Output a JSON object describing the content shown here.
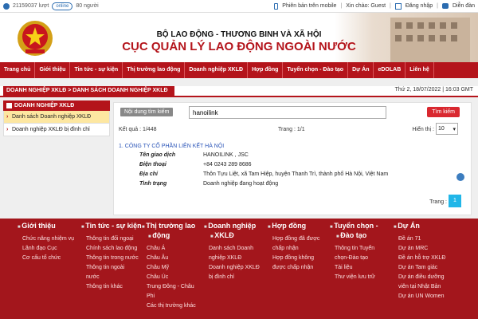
{
  "topbar": {
    "visits": "21159037 lượt",
    "online_label": "online",
    "online_count": "80 người",
    "mobile_link": "Phiên bản trên mobile",
    "greeting": "Xin chào: Guest",
    "register": "Đăng nhập",
    "forum": "Diễn đàn"
  },
  "banner": {
    "ministry": "BỘ LAO ĐỘNG - THƯƠNG BINH VÀ XÃ HỘI",
    "department": "CỤC QUẢN LÝ LAO ĐỘNG NGOÀI NƯỚC"
  },
  "nav": [
    "Trang chủ",
    "Giới thiệu",
    "Tin tức - sự kiện",
    "Thị trường lao động",
    "Doanh nghiệp XKLĐ",
    "Hợp đồng",
    "Tuyển chọn - Đào tạo",
    "Dự Án",
    "eDOLAB",
    "Liên hệ"
  ],
  "breadcrumb": "DOANH NGHIỆP XKLĐ > DANH SÁCH DOANH NGHIỆP XKLĐ",
  "datetime": "Thứ 2, 18/07/2022 | 16:03 GMT",
  "sidebar": {
    "title": "DOANH NGHIỆP XKLĐ",
    "items": [
      "Danh sách Doanh nghiệp XKLĐ",
      "Doanh nghiệp XKLĐ bị đình chỉ"
    ]
  },
  "search": {
    "label": "Nội dung tìm kiếm",
    "value": "hanoilink",
    "button": "Tìm kiếm"
  },
  "results": {
    "count": "Kết quả : 1/448",
    "page": "Trang : 1/1",
    "show_label": "Hiển thị :",
    "show_value": "10"
  },
  "company": {
    "title": "1. CÔNG TY CỔ PHẦN LIÊN KẾT HÀ NỘI",
    "rows": [
      {
        "k": "Tên giao dịch",
        "v": "HANOILINK , JSC"
      },
      {
        "k": "Điện thoại",
        "v": "+84 0243 289 8686"
      },
      {
        "k": "Địa chỉ",
        "v": "Thôn Tựu Liệt, xã Tam Hiệp, huyện Thanh Trì, thành phố Hà Nội, Việt Nam"
      },
      {
        "k": "Tình trạng",
        "v": "Doanh nghiệp đang hoạt động"
      }
    ]
  },
  "pagination": {
    "label": "Trang :",
    "current": "1"
  },
  "footer": [
    {
      "head": "Giới thiệu",
      "links": [
        "Chức năng nhiệm vụ",
        "Lãnh đạo Cục",
        "Cơ cấu tổ chức"
      ]
    },
    {
      "head": "Tin tức - sự kiện",
      "links": [
        "Thông tin đối ngoại",
        "Chính sách lao động",
        "Thông tin trong nước",
        "Thông tin ngoài",
        "nước",
        "Thông tin khác"
      ]
    },
    {
      "head": "Thị trường lao",
      "head2": "động",
      "links": [
        "Châu Á",
        "Châu Âu",
        "Châu Mỹ",
        "Châu Úc",
        "Trung Đông - Châu",
        "Phi",
        "Các thị trường khác"
      ]
    },
    {
      "head": "Doanh nghiệp",
      "head2": "XKLĐ",
      "links": [
        "Danh sách Doanh",
        "nghiệp XKLĐ",
        "Doanh nghiệp XKLĐ",
        "bị đình chỉ"
      ]
    },
    {
      "head": "Hợp đồng",
      "links": [
        "Hợp đồng đã được",
        "chấp nhận",
        "Hợp đồng không",
        "được chấp nhận"
      ]
    },
    {
      "head": "Tuyển chọn -",
      "head2": "Đào tạo",
      "links": [
        "Thông tin Tuyển",
        "chọn-Đào tạo",
        "Tài liệu",
        "Thư viện lưu trữ"
      ]
    },
    {
      "head": "Dự Án",
      "links": [
        "Đề án 71",
        "Dự án MRC",
        "Đề án hỗ trợ XKLĐ",
        "Dự án Tam giác",
        "Dự án điều dưỡng",
        "viên tại Nhật Bản",
        "Dự án UN Women"
      ]
    }
  ],
  "colors": {
    "brand": "#b4141b",
    "footer": "#a3161c",
    "accent": "#21b6e8"
  }
}
